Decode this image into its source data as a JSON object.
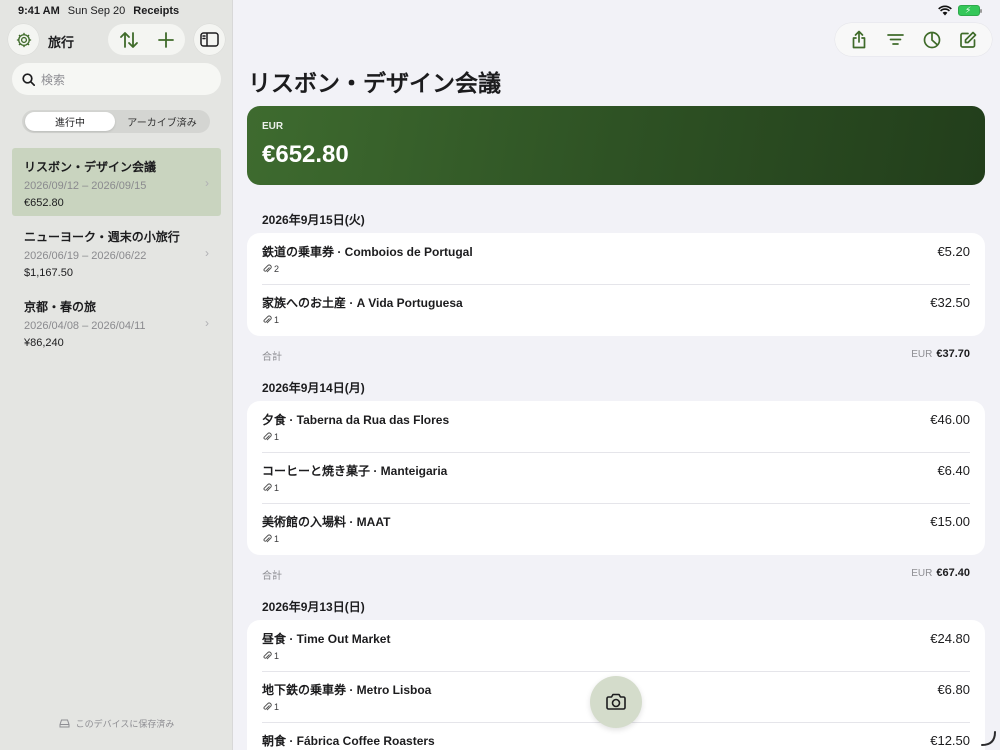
{
  "status_bar": {
    "time": "9:41 AM",
    "date": "Sun Sep 20",
    "app": "Receipts"
  },
  "sidebar": {
    "title": "旅行",
    "search_placeholder": "検索",
    "segments": [
      "進行中",
      "アーカイブ済み"
    ],
    "active_segment": "進行中",
    "trips": [
      {
        "name": "リスボン・デザイン会議",
        "dates": "2026/09/12 – 2026/09/15",
        "total": "€652.80",
        "selected": true
      },
      {
        "name": "ニューヨーク・週末の小旅行",
        "dates": "2026/06/19 – 2026/06/22",
        "total": "$1,167.50",
        "selected": false
      },
      {
        "name": "京都・春の旅",
        "dates": "2026/04/08 – 2026/04/11",
        "total": "¥86,240",
        "selected": false
      }
    ],
    "footer": "このデバイスに保存済み"
  },
  "main": {
    "title": "リスボン・デザイン会議",
    "hero": {
      "currency": "EUR",
      "amount": "€652.80"
    },
    "days": [
      {
        "header": "2026年9月15日(火)",
        "items": [
          {
            "name": "鉄道の乗車券 · Comboios de Portugal",
            "amount": "€5.20",
            "attachments": "2"
          },
          {
            "name": "家族へのお土産 · A Vida Portuguesa",
            "amount": "€32.50",
            "attachments": "1"
          }
        ],
        "subtotal_label": "合計",
        "subtotal_currency": "EUR",
        "subtotal_amount": "€37.70"
      },
      {
        "header": "2026年9月14日(月)",
        "items": [
          {
            "name": "夕食 · Taberna da Rua das Flores",
            "amount": "€46.00",
            "attachments": "1"
          },
          {
            "name": "コーヒーと焼き菓子 · Manteigaria",
            "amount": "€6.40",
            "attachments": "1"
          },
          {
            "name": "美術館の入場料 · MAAT",
            "amount": "€15.00",
            "attachments": "1"
          }
        ],
        "subtotal_label": "合計",
        "subtotal_currency": "EUR",
        "subtotal_amount": "€67.40"
      },
      {
        "header": "2026年9月13日(日)",
        "items": [
          {
            "name": "昼食 · Time Out Market",
            "amount": "€24.80",
            "attachments": "1"
          },
          {
            "name": "地下鉄の乗車券 · Metro Lisboa",
            "amount": "€6.80",
            "attachments": "1"
          },
          {
            "name": "朝食 · Fábrica Coffee Roasters",
            "amount": "€12.50",
            "attachments": ""
          }
        ]
      }
    ]
  },
  "colors": {
    "accent": "#3f6b2a",
    "hero_start": "#3e6b2f",
    "hero_end": "#223e1b",
    "selected_row": "#c9d4bf"
  },
  "icons": {
    "settings": "gear-icon",
    "sort": "sort-arrows-icon",
    "add": "plus-icon",
    "sidebar": "sidebar-toggle-icon",
    "share": "share-icon",
    "filter": "filter-lines-icon",
    "chart": "pie-chart-icon",
    "edit": "compose-icon",
    "camera": "camera-icon",
    "attachment": "paperclip-icon"
  }
}
